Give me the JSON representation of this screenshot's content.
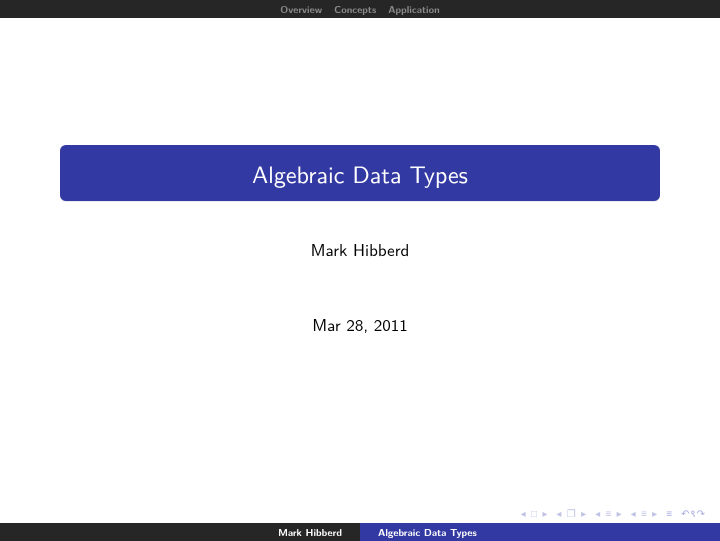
{
  "nav": {
    "items": [
      "Overview",
      "Concepts",
      "Application"
    ]
  },
  "title": "Algebraic Data Types",
  "author": "Mark Hibberd",
  "date": "Mar 28, 2011",
  "footer": {
    "author": "Mark Hibberd",
    "title": "Algebraic Data Types"
  },
  "navsymbols": {
    "s1": "◂ □ ▸",
    "s2": "◂ ❐ ▸",
    "s3": "◂ ≡ ▸",
    "s4": "◂ ≡ ▸",
    "s5": "≡",
    "s6": "↶९↷"
  }
}
